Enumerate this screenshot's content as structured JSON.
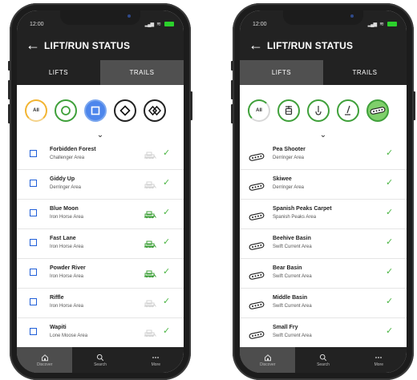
{
  "colors": {
    "accent_blue": "#1f5ed8",
    "check_green": "#4bb543",
    "ring_yellow": "#f2b431",
    "ring_green": "#3fa03a",
    "bar_dark": "#222222"
  },
  "left": {
    "status_time": "12:00",
    "title": "LIFT/RUN STATUS",
    "tabs": [
      {
        "label": "LIFTS",
        "active": false
      },
      {
        "label": "TRAILS",
        "active": true
      }
    ],
    "filters": [
      {
        "icon": "all",
        "label": "All",
        "selected": false
      },
      {
        "icon": "green-circle-icon",
        "selected": false
      },
      {
        "icon": "blue-square-icon",
        "selected": true
      },
      {
        "icon": "black-diamond-icon",
        "selected": false
      },
      {
        "icon": "double-black-diamond-icon",
        "selected": false
      }
    ],
    "rows": [
      {
        "name": "Forbidden Forest",
        "area": "Challenger Area",
        "groomed": false,
        "status": "open"
      },
      {
        "name": "Giddy Up",
        "area": "Derringer Area",
        "groomed": false,
        "status": "open"
      },
      {
        "name": "Blue Moon",
        "area": "Iron Horse Area",
        "groomed": true,
        "status": "open"
      },
      {
        "name": "Fast Lane",
        "area": "Iron Horse Area",
        "groomed": true,
        "status": "open"
      },
      {
        "name": "Powder River",
        "area": "Iron Horse Area",
        "groomed": true,
        "status": "open"
      },
      {
        "name": "Riffle",
        "area": "Iron Horse Area",
        "groomed": false,
        "status": "open"
      },
      {
        "name": "Wapiti",
        "area": "Lone Moose Area",
        "groomed": false,
        "status": "open"
      }
    ],
    "nav": [
      {
        "label": "Discover",
        "icon": "home-icon",
        "active": true
      },
      {
        "label": "Search",
        "icon": "search-icon",
        "active": false
      },
      {
        "label": "More",
        "icon": "more-icon",
        "active": false
      }
    ]
  },
  "right": {
    "status_time": "12:00",
    "title": "LIFT/RUN STATUS",
    "tabs": [
      {
        "label": "LIFTS",
        "active": true
      },
      {
        "label": "TRAILS",
        "active": false
      }
    ],
    "filters": [
      {
        "icon": "all",
        "label": "All",
        "selected": false
      },
      {
        "icon": "gondola-icon",
        "selected": false
      },
      {
        "icon": "chairlift-icon",
        "selected": false
      },
      {
        "icon": "surface-lift-icon",
        "selected": false
      },
      {
        "icon": "carpet-icon",
        "selected": true
      }
    ],
    "rows": [
      {
        "name": "Pea Shooter",
        "area": "Derringer Area",
        "status": "open"
      },
      {
        "name": "Skiwee",
        "area": "Derringer Area",
        "status": "open"
      },
      {
        "name": "Spanish Peaks Carpet",
        "area": "Spanish Peaks Area",
        "status": "open"
      },
      {
        "name": "Beehive Basin",
        "area": "Swift Current Area",
        "status": "open"
      },
      {
        "name": "Bear Basin",
        "area": "Swift Current Area",
        "status": "open"
      },
      {
        "name": "Middle Basin",
        "area": "Swift Current Area",
        "status": "open"
      },
      {
        "name": "Small Fry",
        "area": "Swift Current Area",
        "status": "open"
      }
    ],
    "nav": [
      {
        "label": "Discover",
        "icon": "home-icon",
        "active": true
      },
      {
        "label": "Search",
        "icon": "search-icon",
        "active": false
      },
      {
        "label": "More",
        "icon": "more-icon",
        "active": false
      }
    ]
  }
}
